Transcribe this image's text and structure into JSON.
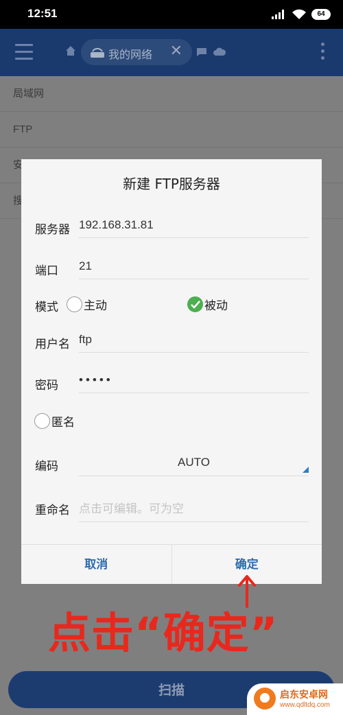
{
  "status_bar": {
    "time": "12:51",
    "battery": "64"
  },
  "app_bar": {
    "tab_label": "我的网络",
    "tab_close": "✕"
  },
  "background_list": [
    {
      "label": "局域网"
    },
    {
      "label": "FTP"
    },
    {
      "label": "安"
    },
    {
      "label": "搜"
    }
  ],
  "dialog": {
    "title": "新建 FTP服务器",
    "server": {
      "label": "服务器",
      "value": "192.168.31.81"
    },
    "port": {
      "label": "端口",
      "value": "21"
    },
    "mode": {
      "label": "模式",
      "options": [
        "主动",
        "被动"
      ],
      "selected": "被动"
    },
    "username": {
      "label": "用户名",
      "value": "ftp"
    },
    "password": {
      "label": "密码",
      "value": "•••••"
    },
    "anonymous": {
      "label": "匿名",
      "checked": false
    },
    "encoding": {
      "label": "编码",
      "value": "AUTO"
    },
    "rename": {
      "label": "重命名",
      "placeholder": "点击可编辑。可为空"
    },
    "cancel": "取消",
    "confirm": "确定"
  },
  "annotation": {
    "text": "点击“确定”",
    "color": "#e8281d"
  },
  "scan_button": {
    "label": "扫描"
  },
  "watermark": {
    "name": "启东安卓网",
    "url": "www.qdltdq.com"
  },
  "colors": {
    "accent": "#2b6cb0",
    "check": "#4caf50",
    "appbar": "#1a3a6e"
  }
}
